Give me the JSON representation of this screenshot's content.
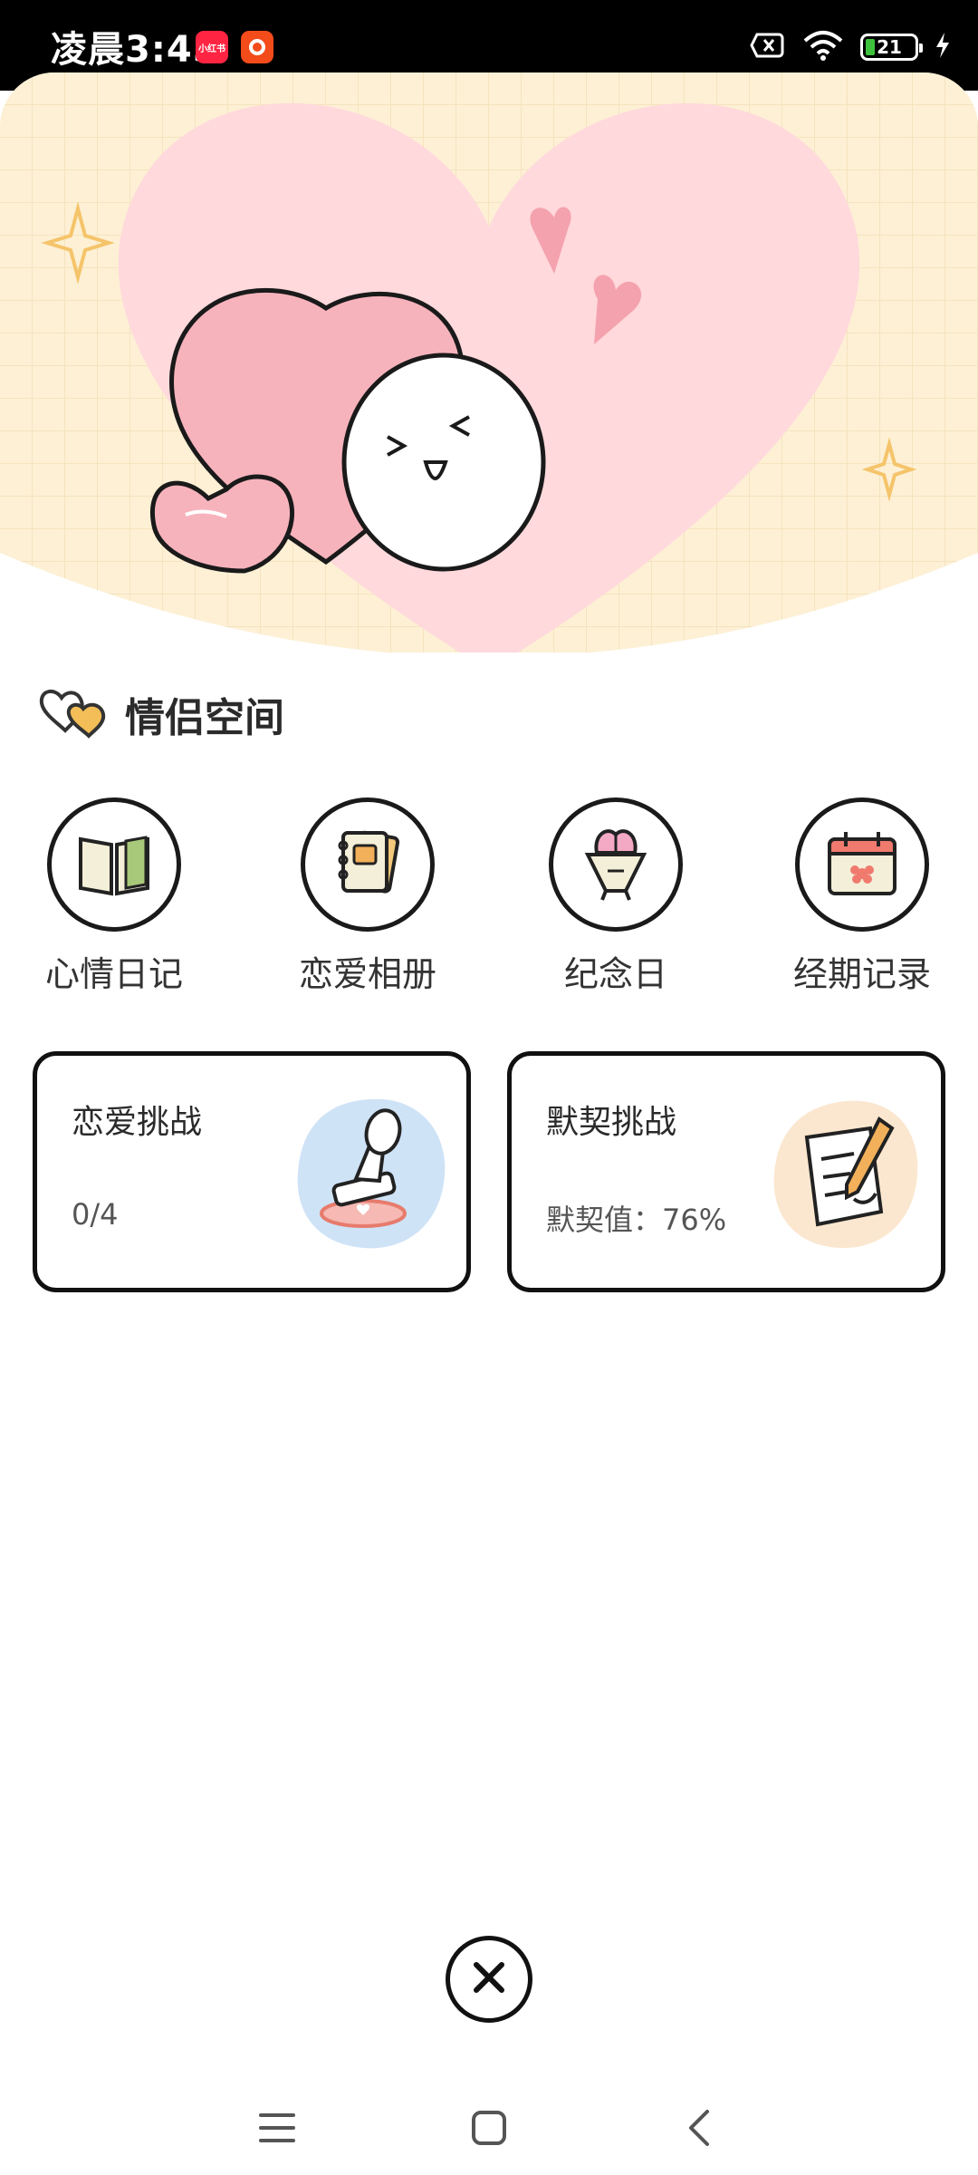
{
  "status_bar": {
    "time": "凌晨3:45",
    "app_badges": [
      "小红书",
      "拼多多"
    ],
    "battery_level": "21",
    "icons": [
      "sim-off-icon",
      "wifi-icon",
      "battery-icon",
      "charging-icon"
    ]
  },
  "section": {
    "title": "情侣空间",
    "icon": "couple-hearts-icon"
  },
  "features": [
    {
      "label": "心情日记",
      "icon": "book-icon"
    },
    {
      "label": "恋爱相册",
      "icon": "album-icon"
    },
    {
      "label": "纪念日",
      "icon": "bouquet-icon"
    },
    {
      "label": "经期记录",
      "icon": "calendar-icon"
    }
  ],
  "cards": [
    {
      "title": "恋爱挑战",
      "value": "0/4",
      "icon": "stamp-icon"
    },
    {
      "title": "默契挑战",
      "value_label": "默契值：",
      "value": "76%",
      "icon": "note-pencil-icon"
    }
  ],
  "nav": {
    "icons": [
      "menu-icon",
      "home-icon",
      "back-icon"
    ]
  },
  "colors": {
    "banner_bg": "#fdf0d5",
    "heart_pink": "#ffd9dc",
    "accent_pink": "#f4a2ad",
    "border": "#111111"
  }
}
